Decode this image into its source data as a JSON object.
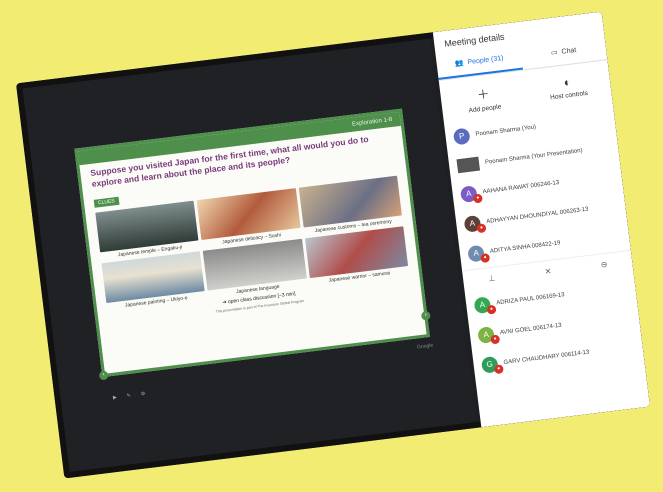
{
  "panel": {
    "title": "Meeting details",
    "tabs": [
      {
        "label": "People (31)",
        "icon": "people-icon"
      },
      {
        "label": "Chat",
        "icon": "chat-icon"
      }
    ],
    "actions": [
      {
        "label": "Add people",
        "icon": "add-person-icon"
      },
      {
        "label": "Host controls",
        "icon": "toggle-icon"
      }
    ],
    "participants": [
      {
        "initial": "P",
        "name": "Poonam Sharma (You)",
        "color": "#5b6bbf",
        "muted": false
      },
      {
        "initial": "",
        "name": "Poonam Sharma (Your Presentation)",
        "color": "#555555",
        "muted": false
      },
      {
        "initial": "A",
        "name": "AAHANA RAWAT 006246-13",
        "color": "#7c5cc4",
        "muted": true
      },
      {
        "initial": "A",
        "name": "ADHAYYAN DHOUNDIYAL 006263-13",
        "color": "#5d4037",
        "muted": true
      },
      {
        "initial": "A",
        "name": "ADITYA SINHA 008422-19",
        "color": "#6e8bb0",
        "muted": true
      },
      {
        "initial": "A",
        "name": "ADRIZA PAUL 006169-13",
        "color": "#33a852",
        "muted": true
      },
      {
        "initial": "A",
        "name": "AVNI GOEL 006174-13",
        "color": "#7cb342",
        "muted": true
      },
      {
        "initial": "G",
        "name": "GARV CHAUDHARY 006114-13",
        "color": "#2e9d59",
        "muted": true
      }
    ]
  },
  "slide": {
    "header": "Exploration 1-8",
    "title": "Suppose you visited Japan for the first time, what all would you do to explore and learn about the place and its people?",
    "clues_label": "CLUES",
    "cells": [
      "Japanese temple – Engaku-ji",
      "Japanese delicacy – Sushi",
      "Japanese customs – tea ceremony",
      "Japanese painting – Ukiyo-e",
      "Japanese language",
      "Japanese warrior – samurai"
    ],
    "discussion": "➔ open class discussion [~3 min]",
    "footnote": "This presentation is part of The Inventure Global Program",
    "google": "Google"
  },
  "colors": {
    "accent": "#1a73e8",
    "slide_green": "#4d8f4b",
    "title_purple": "#7a3b7c"
  }
}
